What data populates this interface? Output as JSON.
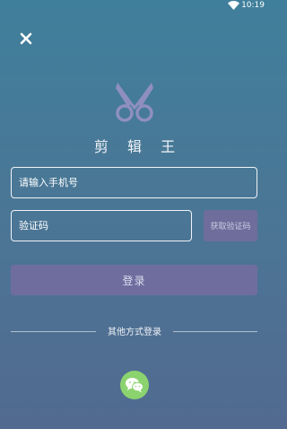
{
  "status_bar": {
    "time": "10:19",
    "wifi_icon": "wifi-icon"
  },
  "header": {
    "close_icon": "close-icon"
  },
  "brand": {
    "logo_icon": "scissors-icon",
    "app_name": "剪 辑 王"
  },
  "form": {
    "phone_placeholder": "请输入手机号",
    "phone_value": "",
    "code_placeholder": "验证码",
    "code_value": "",
    "get_code_label": "获取验证码",
    "login_label": "登录"
  },
  "other_login": {
    "label": "其他方式登录",
    "wechat_icon": "wechat-icon"
  },
  "colors": {
    "background_top": "#3f7f9b",
    "background_bottom": "#526a90",
    "button_purple": "#6e6d9e",
    "wechat_green": "#8bd36f"
  }
}
